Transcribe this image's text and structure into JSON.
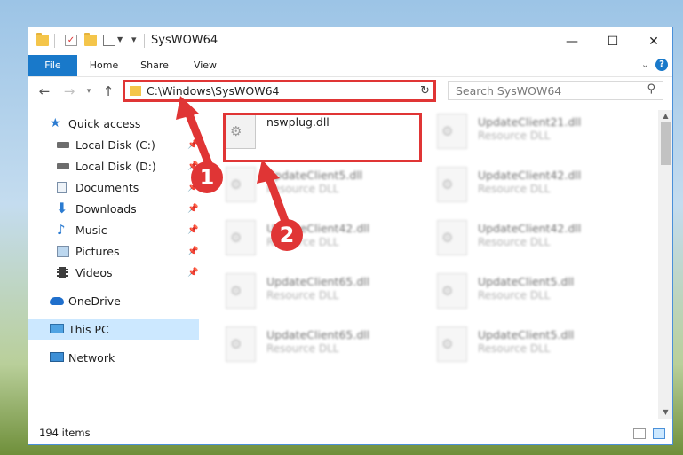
{
  "window": {
    "title": "SysWOW64",
    "controls": {
      "minimize": "—",
      "maximize": "☐",
      "close": "✕"
    }
  },
  "ribbon": {
    "tabs": [
      "File",
      "Home",
      "Share",
      "View"
    ],
    "help": "?"
  },
  "navbar": {
    "address": "C:\\Windows\\SysWOW64",
    "search_placeholder": "Search SysWOW64"
  },
  "sidebar": {
    "items": [
      {
        "label": "Quick access",
        "icon": "star-icon",
        "pinned": false
      },
      {
        "label": "Local Disk (C:)",
        "icon": "drive-icon",
        "pinned": true
      },
      {
        "label": "Local Disk (D:)",
        "icon": "drive-icon",
        "pinned": true
      },
      {
        "label": "Documents",
        "icon": "documents-icon",
        "pinned": true
      },
      {
        "label": "Downloads",
        "icon": "download-icon",
        "pinned": true
      },
      {
        "label": "Music",
        "icon": "music-icon",
        "pinned": true
      },
      {
        "label": "Pictures",
        "icon": "pictures-icon",
        "pinned": true
      },
      {
        "label": "Videos",
        "icon": "videos-icon",
        "pinned": true
      },
      {
        "label": "OneDrive",
        "icon": "cloud-icon",
        "pinned": false
      },
      {
        "label": "This PC",
        "icon": "computer-icon",
        "pinned": false,
        "selected": true
      },
      {
        "label": "Network",
        "icon": "network-icon",
        "pinned": false
      }
    ]
  },
  "files": [
    {
      "name": "nswplug.dll",
      "type": "",
      "highlighted": true
    },
    {
      "name": "UpdateClient21.dll",
      "type": "Resource DLL"
    },
    {
      "name": "UpdateClient5.dll",
      "type": "Resource DLL"
    },
    {
      "name": "UpdateClient42.dll",
      "type": "Resource DLL"
    },
    {
      "name": "UpdateClient42.dll",
      "type": "Resource DLL"
    },
    {
      "name": "UpdateClient42.dll",
      "type": "Resource DLL"
    },
    {
      "name": "UpdateClient65.dll",
      "type": "Resource DLL"
    },
    {
      "name": "UpdateClient5.dll",
      "type": "Resource DLL"
    },
    {
      "name": "UpdateClient65.dll",
      "type": "Resource DLL"
    },
    {
      "name": "UpdateClient5.dll",
      "type": "Resource DLL"
    }
  ],
  "status": {
    "item_count": "194 items"
  },
  "annotations": {
    "step1": "1",
    "step2": "2",
    "color": "#e03535"
  }
}
